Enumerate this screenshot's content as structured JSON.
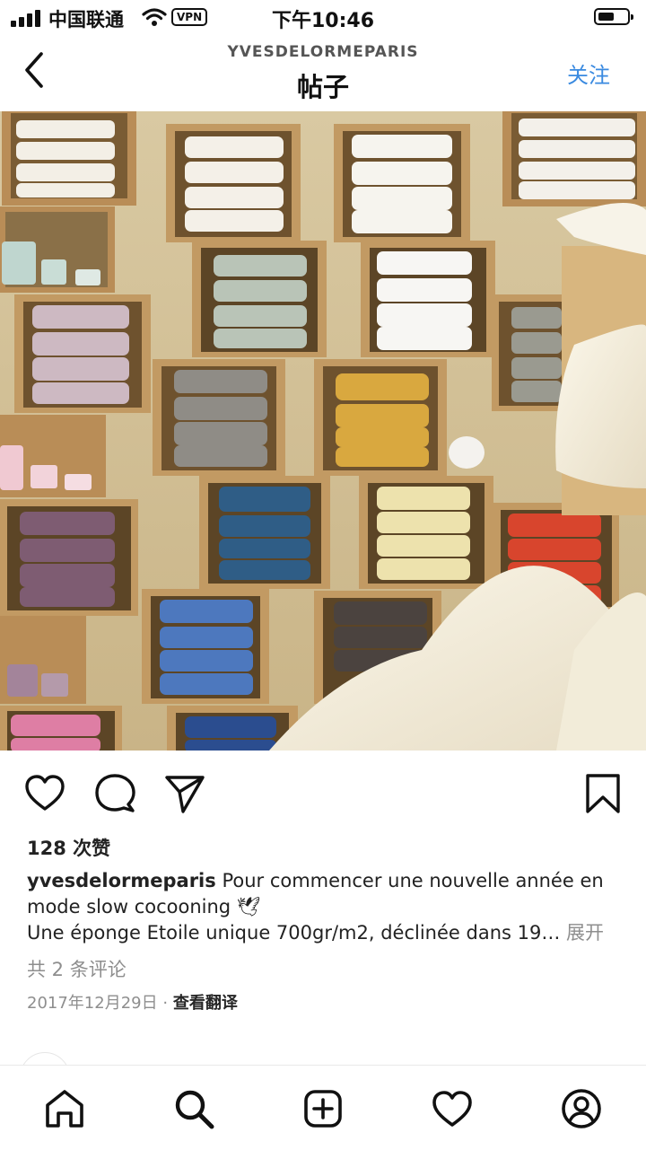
{
  "status_bar": {
    "carrier": "中国联通",
    "vpn": "VPN",
    "time": "下午10:46"
  },
  "header": {
    "account": "YVESDELORMEPARIS",
    "title": "帖子",
    "follow_label": "关注",
    "back_icon": "chevron-left-icon"
  },
  "post": {
    "image_desc_icon": "towel-shelves-photo",
    "likes": "128 次赞",
    "caption": {
      "username": "yvesdelormeparis",
      "line1": "Pour commencer une nouvelle année en mode slow cocooning 🕊",
      "line2": "Une éponge Etoile unique 700gr/m2, déclinée dans 19…",
      "more": "展开"
    },
    "comments": "共 2 条评论",
    "date": "2017年12月29日",
    "separator": "·",
    "translate": "查看翻译"
  },
  "actions": {
    "like_icon": "heart-icon",
    "comment_icon": "comment-icon",
    "share_icon": "send-icon",
    "save_icon": "bookmark-icon"
  },
  "tabbar": {
    "icons": [
      "home-icon",
      "search-icon",
      "add-post-icon",
      "activity-heart-icon",
      "profile-icon"
    ]
  },
  "colors": {
    "follow_blue": "#3a8ae0",
    "muted_gray": "#8e8e8e"
  }
}
